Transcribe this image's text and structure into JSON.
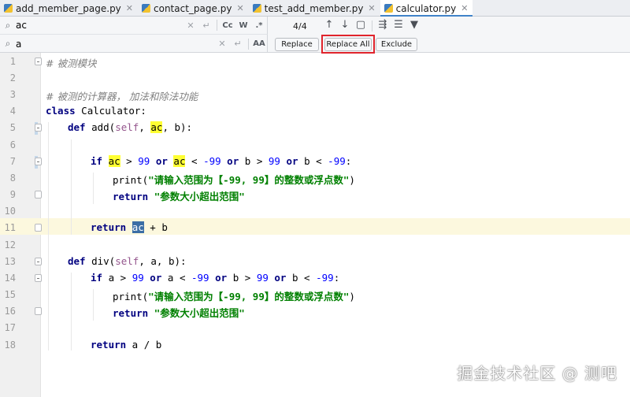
{
  "tabs": [
    {
      "label": "add_member_page.py",
      "active": false
    },
    {
      "label": "contact_page.py",
      "active": false
    },
    {
      "label": "test_add_member.py",
      "active": false
    },
    {
      "label": "calculator.py",
      "active": true
    }
  ],
  "find": {
    "search_value": "ac",
    "replace_value": "a",
    "match_count": "4/4",
    "options": {
      "case": "Cc",
      "words": "W",
      "regex": ".*",
      "preserve_case": "AA"
    }
  },
  "replace": {
    "replace_label": "Replace",
    "replace_all_label": "Replace All",
    "exclude_label": "Exclude"
  },
  "code": {
    "line_numbers": [
      "1",
      "2",
      "3",
      "4",
      "5",
      "6",
      "7",
      "8",
      "9",
      "10",
      "11",
      "12",
      "13",
      "14",
      "15",
      "16",
      "17",
      "18"
    ],
    "l1_comment": "# 被测模块",
    "l3_comment": "# 被测的计算器， 加法和除法功能",
    "kw_class": "class",
    "class_name": " Calculator:",
    "kw_def": "def",
    "add_sig_1": " add(",
    "self": "self",
    "sep": ", ",
    "ac": "ac",
    "add_sig_2": ", b):",
    "kw_if": "if",
    "kw_or": "or",
    "gt": " > ",
    "lt": " < ",
    "n99": "99",
    "nm99": "-99",
    "b": "b",
    "colon": ":",
    "print_open": "print(",
    "print_str": "\"请输入范围为【-99, 99】的整数或浮点数\"",
    "print_close": ")",
    "kw_return": "return",
    "ret_str": "\"参数大小超出范围\"",
    "plus_b": " + b",
    "div_sig_1": " div(",
    "div_sig_2": ", a, b):",
    "a": "a",
    "div_ret": " a / b"
  },
  "watermark": "掘金技术社区 @ 测吧"
}
